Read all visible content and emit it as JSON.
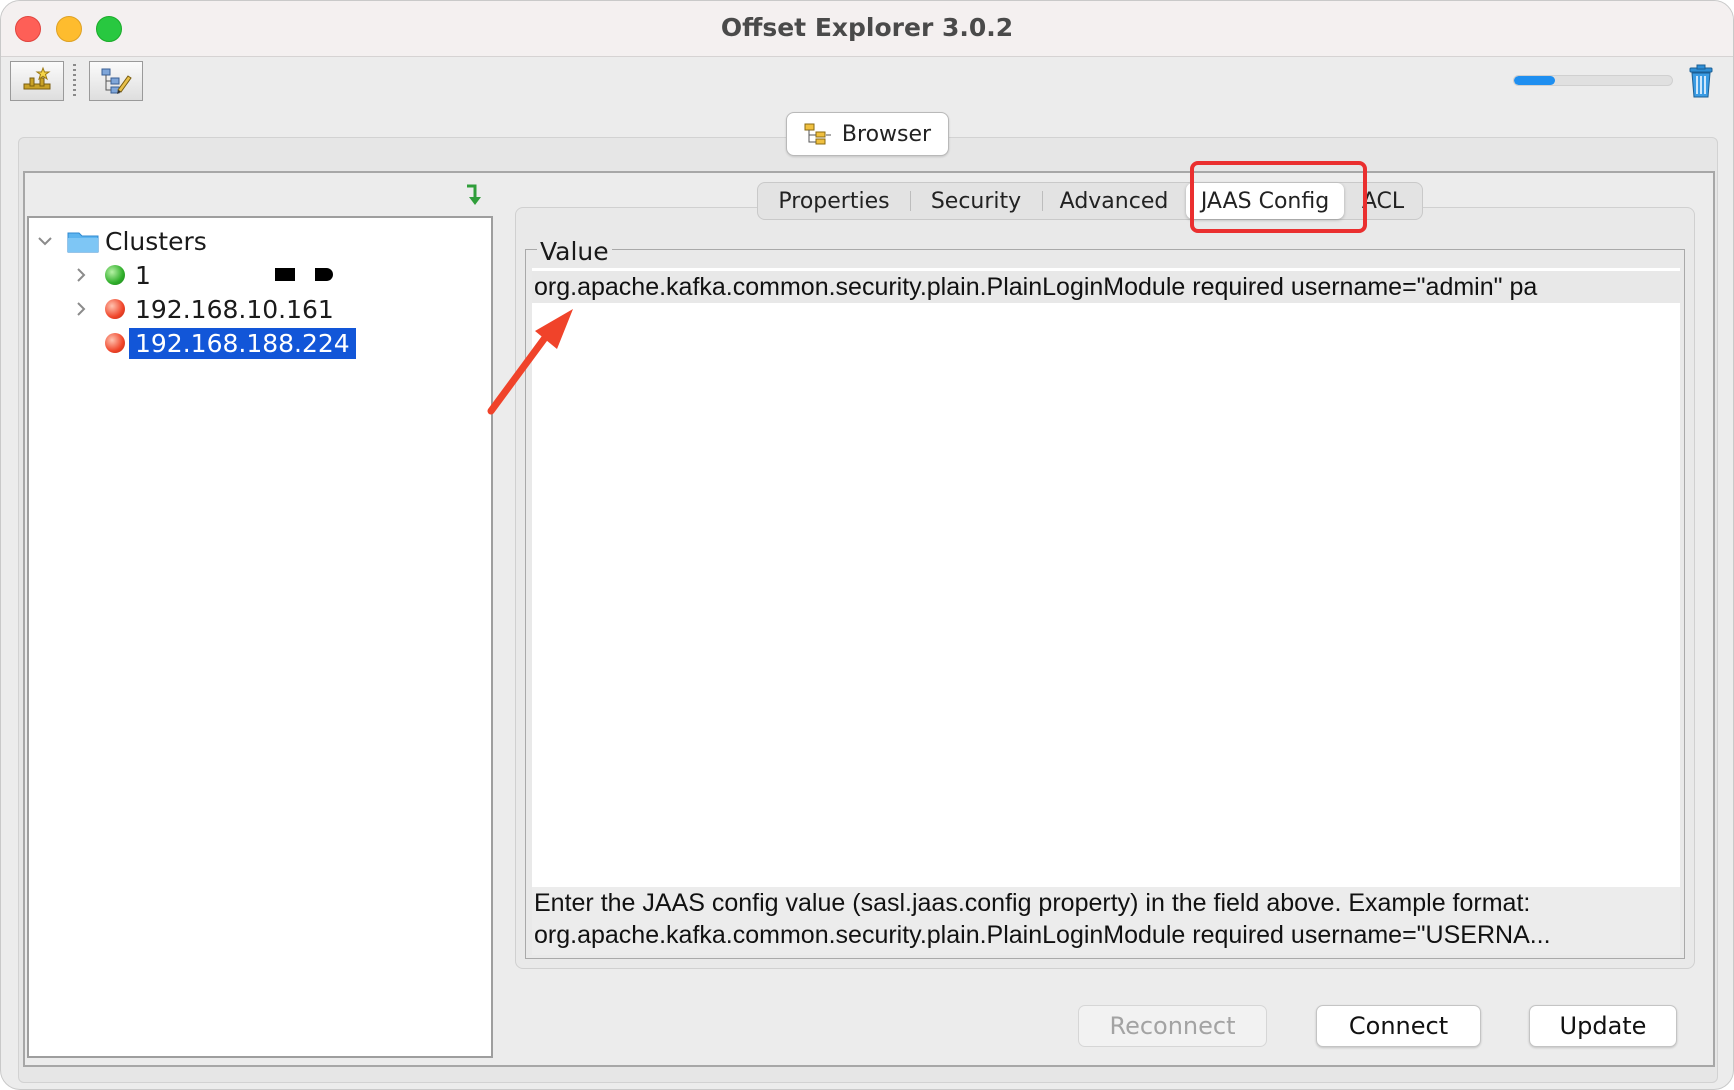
{
  "window": {
    "title": "Offset Explorer  3.0.2"
  },
  "toolbar": {
    "new_connection_icon": "connection-add-icon",
    "edit_icon": "tree-edit-icon",
    "progress_value": 0.26,
    "trash_icon": "trash-icon"
  },
  "browser_button": {
    "label": "Browser"
  },
  "tree": {
    "root_label": "Clusters",
    "nodes": [
      {
        "label": "1",
        "status": "connected",
        "status_color": "#2fae2a",
        "expandable": true,
        "selected": false
      },
      {
        "label": "192.168.10.161",
        "status": "disconnected",
        "status_color": "#f0452a",
        "expandable": true,
        "selected": false
      },
      {
        "label": "192.168.188.224",
        "status": "disconnected",
        "status_color": "#f0452a",
        "expandable": false,
        "selected": true
      }
    ]
  },
  "tabs": [
    {
      "label": "Properties",
      "active": false
    },
    {
      "label": "Security",
      "active": false
    },
    {
      "label": "Advanced",
      "active": false
    },
    {
      "label": "JAAS Config",
      "active": true
    },
    {
      "label": "ACL",
      "active": false
    }
  ],
  "value_panel": {
    "legend": "Value",
    "value": "org.apache.kafka.common.security.plain.PlainLoginModule required  username=\"admin\" pa",
    "help_line_1": "Enter the JAAS config value (sasl.jaas.config property) in the field above. Example format:",
    "help_line_2": "org.apache.kafka.common.security.plain.PlainLoginModule required username=\"USERNA..."
  },
  "buttons": {
    "reconnect": "Reconnect",
    "connect": "Connect",
    "update": "Update"
  },
  "colors": {
    "selection": "#1256d8",
    "annotation": "#ea2f2f",
    "progress": "#1f8ff0"
  }
}
